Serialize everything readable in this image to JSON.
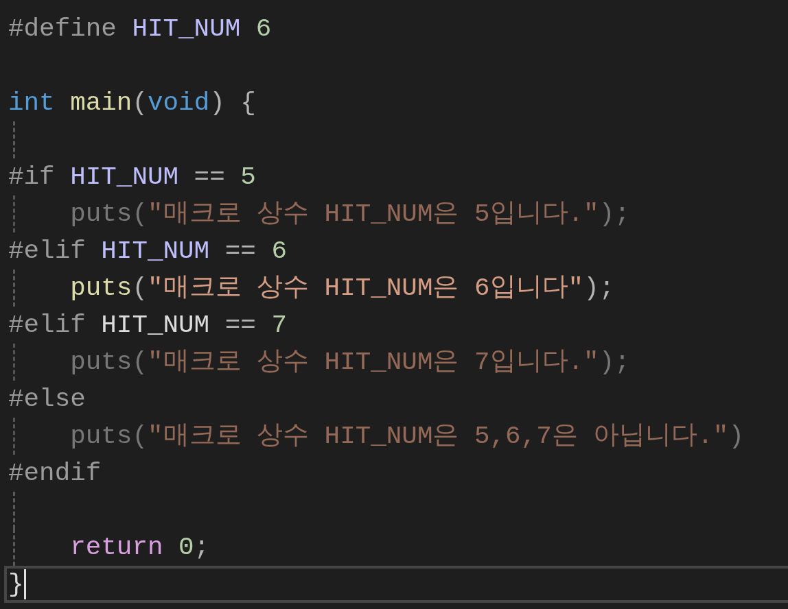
{
  "editor": {
    "lines": [
      {
        "indented": false,
        "dimmed": false,
        "current": false,
        "tokens": [
          {
            "text": "#define",
            "kind": "preprocessor"
          },
          {
            "text": " HIT_NUM",
            "kind": "macro"
          },
          {
            "text": " 6",
            "kind": "number"
          }
        ]
      },
      {
        "indented": false,
        "current": false
      },
      {
        "indented": false,
        "dimmed": false,
        "current": false,
        "tokens": [
          {
            "text": "int",
            "kind": "keyword"
          },
          {
            "text": " main",
            "kind": "function"
          },
          {
            "text": "(",
            "kind": "punctuation"
          },
          {
            "text": "void",
            "kind": "keyword"
          },
          {
            "text": ") {",
            "kind": "punctuation"
          }
        ]
      },
      {
        "indented": true,
        "current": false
      },
      {
        "indented": false,
        "dimmed": false,
        "current": false,
        "tokens": [
          {
            "text": "#if",
            "kind": "preprocessor"
          },
          {
            "text": " HIT_NUM",
            "kind": "macro"
          },
          {
            "text": " ==",
            "kind": "punctuation"
          },
          {
            "text": " 5",
            "kind": "number"
          }
        ]
      },
      {
        "indented": true,
        "dimmed": true,
        "current": false,
        "tokens": [
          {
            "text": "puts",
            "kind": "function"
          },
          {
            "text": "(",
            "kind": "punctuation"
          },
          {
            "text": "\"매크로 상수 HIT_NUM은 5입니다.\"",
            "kind": "string"
          },
          {
            "text": ");",
            "kind": "punctuation"
          }
        ]
      },
      {
        "indented": false,
        "dimmed": false,
        "current": false,
        "tokens": [
          {
            "text": "#elif",
            "kind": "preprocessor"
          },
          {
            "text": " HIT_NUM",
            "kind": "macro"
          },
          {
            "text": " ==",
            "kind": "punctuation"
          },
          {
            "text": " 6",
            "kind": "number"
          }
        ]
      },
      {
        "indented": true,
        "dimmed": false,
        "current": false,
        "tokens": [
          {
            "text": "puts",
            "kind": "function"
          },
          {
            "text": "(",
            "kind": "punctuation"
          },
          {
            "text": "\"매크로 상수 HIT_NUM은 6입니다\"",
            "kind": "string"
          },
          {
            "text": ");",
            "kind": "punctuation"
          }
        ]
      },
      {
        "indented": false,
        "dimmed": false,
        "current": false,
        "tokens": [
          {
            "text": "#elif",
            "kind": "preprocessor"
          },
          {
            "text": " HIT_NUM",
            "kind": "plain"
          },
          {
            "text": " ==",
            "kind": "punctuation"
          },
          {
            "text": " 7",
            "kind": "number"
          }
        ]
      },
      {
        "indented": true,
        "dimmed": true,
        "current": false,
        "tokens": [
          {
            "text": "puts",
            "kind": "function"
          },
          {
            "text": "(",
            "kind": "punctuation"
          },
          {
            "text": "\"매크로 상수 HIT_NUM은 7입니다.\"",
            "kind": "string"
          },
          {
            "text": ");",
            "kind": "punctuation"
          }
        ]
      },
      {
        "indented": false,
        "dimmed": false,
        "current": false,
        "tokens": [
          {
            "text": "#else",
            "kind": "preprocessor"
          }
        ]
      },
      {
        "indented": true,
        "dimmed": true,
        "current": false,
        "tokens": [
          {
            "text": "puts",
            "kind": "function"
          },
          {
            "text": "(",
            "kind": "punctuation"
          },
          {
            "text": "\"매크로 상수 HIT_NUM은 5,6,7은 아닙니다.\"",
            "kind": "string"
          },
          {
            "text": ")",
            "kind": "punctuation"
          }
        ]
      },
      {
        "indented": false,
        "dimmed": false,
        "current": false,
        "tokens": [
          {
            "text": "#endif",
            "kind": "preprocessor"
          }
        ]
      },
      {
        "indented": true,
        "current": false
      },
      {
        "indented": true,
        "dimmed": false,
        "current": false,
        "tokens": [
          {
            "text": "return",
            "kind": "control"
          },
          {
            "text": " 0",
            "kind": "number"
          },
          {
            "text": ";",
            "kind": "punctuation"
          }
        ]
      },
      {
        "indented": false,
        "dimmed": false,
        "current": true,
        "tokens": [
          {
            "text": "}",
            "kind": "plain"
          }
        ]
      }
    ]
  }
}
